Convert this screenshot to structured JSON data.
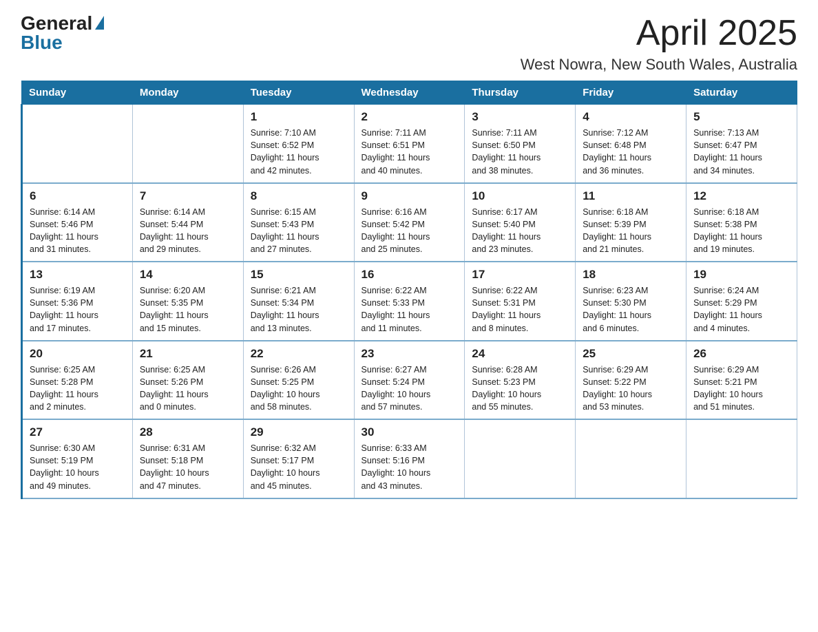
{
  "header": {
    "logo_general": "General",
    "logo_blue": "Blue",
    "title": "April 2025",
    "subtitle": "West Nowra, New South Wales, Australia"
  },
  "days_of_week": [
    "Sunday",
    "Monday",
    "Tuesday",
    "Wednesday",
    "Thursday",
    "Friday",
    "Saturday"
  ],
  "weeks": [
    [
      {
        "day": "",
        "info": ""
      },
      {
        "day": "",
        "info": ""
      },
      {
        "day": "1",
        "info": "Sunrise: 7:10 AM\nSunset: 6:52 PM\nDaylight: 11 hours\nand 42 minutes."
      },
      {
        "day": "2",
        "info": "Sunrise: 7:11 AM\nSunset: 6:51 PM\nDaylight: 11 hours\nand 40 minutes."
      },
      {
        "day": "3",
        "info": "Sunrise: 7:11 AM\nSunset: 6:50 PM\nDaylight: 11 hours\nand 38 minutes."
      },
      {
        "day": "4",
        "info": "Sunrise: 7:12 AM\nSunset: 6:48 PM\nDaylight: 11 hours\nand 36 minutes."
      },
      {
        "day": "5",
        "info": "Sunrise: 7:13 AM\nSunset: 6:47 PM\nDaylight: 11 hours\nand 34 minutes."
      }
    ],
    [
      {
        "day": "6",
        "info": "Sunrise: 6:14 AM\nSunset: 5:46 PM\nDaylight: 11 hours\nand 31 minutes."
      },
      {
        "day": "7",
        "info": "Sunrise: 6:14 AM\nSunset: 5:44 PM\nDaylight: 11 hours\nand 29 minutes."
      },
      {
        "day": "8",
        "info": "Sunrise: 6:15 AM\nSunset: 5:43 PM\nDaylight: 11 hours\nand 27 minutes."
      },
      {
        "day": "9",
        "info": "Sunrise: 6:16 AM\nSunset: 5:42 PM\nDaylight: 11 hours\nand 25 minutes."
      },
      {
        "day": "10",
        "info": "Sunrise: 6:17 AM\nSunset: 5:40 PM\nDaylight: 11 hours\nand 23 minutes."
      },
      {
        "day": "11",
        "info": "Sunrise: 6:18 AM\nSunset: 5:39 PM\nDaylight: 11 hours\nand 21 minutes."
      },
      {
        "day": "12",
        "info": "Sunrise: 6:18 AM\nSunset: 5:38 PM\nDaylight: 11 hours\nand 19 minutes."
      }
    ],
    [
      {
        "day": "13",
        "info": "Sunrise: 6:19 AM\nSunset: 5:36 PM\nDaylight: 11 hours\nand 17 minutes."
      },
      {
        "day": "14",
        "info": "Sunrise: 6:20 AM\nSunset: 5:35 PM\nDaylight: 11 hours\nand 15 minutes."
      },
      {
        "day": "15",
        "info": "Sunrise: 6:21 AM\nSunset: 5:34 PM\nDaylight: 11 hours\nand 13 minutes."
      },
      {
        "day": "16",
        "info": "Sunrise: 6:22 AM\nSunset: 5:33 PM\nDaylight: 11 hours\nand 11 minutes."
      },
      {
        "day": "17",
        "info": "Sunrise: 6:22 AM\nSunset: 5:31 PM\nDaylight: 11 hours\nand 8 minutes."
      },
      {
        "day": "18",
        "info": "Sunrise: 6:23 AM\nSunset: 5:30 PM\nDaylight: 11 hours\nand 6 minutes."
      },
      {
        "day": "19",
        "info": "Sunrise: 6:24 AM\nSunset: 5:29 PM\nDaylight: 11 hours\nand 4 minutes."
      }
    ],
    [
      {
        "day": "20",
        "info": "Sunrise: 6:25 AM\nSunset: 5:28 PM\nDaylight: 11 hours\nand 2 minutes."
      },
      {
        "day": "21",
        "info": "Sunrise: 6:25 AM\nSunset: 5:26 PM\nDaylight: 11 hours\nand 0 minutes."
      },
      {
        "day": "22",
        "info": "Sunrise: 6:26 AM\nSunset: 5:25 PM\nDaylight: 10 hours\nand 58 minutes."
      },
      {
        "day": "23",
        "info": "Sunrise: 6:27 AM\nSunset: 5:24 PM\nDaylight: 10 hours\nand 57 minutes."
      },
      {
        "day": "24",
        "info": "Sunrise: 6:28 AM\nSunset: 5:23 PM\nDaylight: 10 hours\nand 55 minutes."
      },
      {
        "day": "25",
        "info": "Sunrise: 6:29 AM\nSunset: 5:22 PM\nDaylight: 10 hours\nand 53 minutes."
      },
      {
        "day": "26",
        "info": "Sunrise: 6:29 AM\nSunset: 5:21 PM\nDaylight: 10 hours\nand 51 minutes."
      }
    ],
    [
      {
        "day": "27",
        "info": "Sunrise: 6:30 AM\nSunset: 5:19 PM\nDaylight: 10 hours\nand 49 minutes."
      },
      {
        "day": "28",
        "info": "Sunrise: 6:31 AM\nSunset: 5:18 PM\nDaylight: 10 hours\nand 47 minutes."
      },
      {
        "day": "29",
        "info": "Sunrise: 6:32 AM\nSunset: 5:17 PM\nDaylight: 10 hours\nand 45 minutes."
      },
      {
        "day": "30",
        "info": "Sunrise: 6:33 AM\nSunset: 5:16 PM\nDaylight: 10 hours\nand 43 minutes."
      },
      {
        "day": "",
        "info": ""
      },
      {
        "day": "",
        "info": ""
      },
      {
        "day": "",
        "info": ""
      }
    ]
  ]
}
